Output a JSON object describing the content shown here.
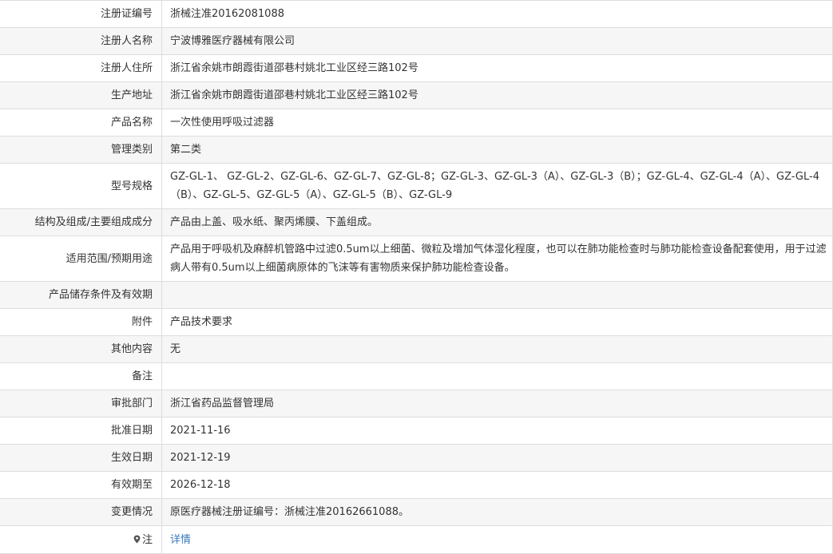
{
  "rows": [
    {
      "label": "注册证编号",
      "value": "浙械注准20162081088"
    },
    {
      "label": "注册人名称",
      "value": "宁波博雅医疗器械有限公司"
    },
    {
      "label": "注册人住所",
      "value": "浙江省余姚市朗霞街道邵巷村姚北工业区经三路102号"
    },
    {
      "label": "生产地址",
      "value": "浙江省余姚市朗霞街道邵巷村姚北工业区经三路102号"
    },
    {
      "label": "产品名称",
      "value": "一次性使用呼吸过滤器"
    },
    {
      "label": "管理类别",
      "value": "第二类"
    },
    {
      "label": "型号规格",
      "value": "GZ-GL-1、 GZ-GL-2、GZ-GL-6、GZ-GL-7、GZ-GL-8；GZ-GL-3、GZ-GL-3（A）、GZ-GL-3（B）；GZ-GL-4、GZ-GL-4（A）、GZ-GL-4（B）、GZ-GL-5、GZ-GL-5（A）、GZ-GL-5（B）、GZ-GL-9"
    },
    {
      "label": "结构及组成/主要组成成分",
      "value": "产品由上盖、吸水纸、聚丙烯膜、下盖组成。"
    },
    {
      "label": "适用范围/预期用途",
      "value": "产品用于呼吸机及麻醉机管路中过滤0.5um以上细菌、微粒及增加气体湿化程度，也可以在肺功能检查时与肺功能检查设备配套使用，用于过滤病人带有0.5um以上细菌病原体的飞沫等有害物质来保护肺功能检查设备。"
    },
    {
      "label": "产品储存条件及有效期",
      "value": ""
    },
    {
      "label": "附件",
      "value": "产品技术要求"
    },
    {
      "label": "其他内容",
      "value": "无"
    },
    {
      "label": "备注",
      "value": ""
    },
    {
      "label": "审批部门",
      "value": "浙江省药品监督管理局"
    },
    {
      "label": "批准日期",
      "value": "2021-11-16"
    },
    {
      "label": "生效日期",
      "value": "2021-12-19"
    },
    {
      "label": "有效期至",
      "value": "2026-12-18"
    },
    {
      "label": "变更情况",
      "value": "原医疗器械注册证编号：浙械注准20162661088。"
    }
  ],
  "note": {
    "label": "注",
    "icon": "location-pin-icon",
    "link_text": "详情",
    "link_color": "#3a7bbd"
  }
}
